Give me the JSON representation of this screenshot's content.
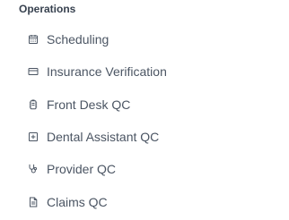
{
  "section": {
    "title": "Operations"
  },
  "items": [
    {
      "label": "Scheduling",
      "icon": "calendar-icon"
    },
    {
      "label": "Insurance Verification",
      "icon": "credit-card-icon"
    },
    {
      "label": "Front Desk QC",
      "icon": "clipboard-icon"
    },
    {
      "label": "Dental Assistant QC",
      "icon": "plus-square-icon"
    },
    {
      "label": "Provider QC",
      "icon": "stethoscope-icon"
    },
    {
      "label": "Claims QC",
      "icon": "file-text-icon"
    }
  ],
  "colors": {
    "text": "#4b5563",
    "title": "#37414f",
    "background": "#ffffff"
  }
}
